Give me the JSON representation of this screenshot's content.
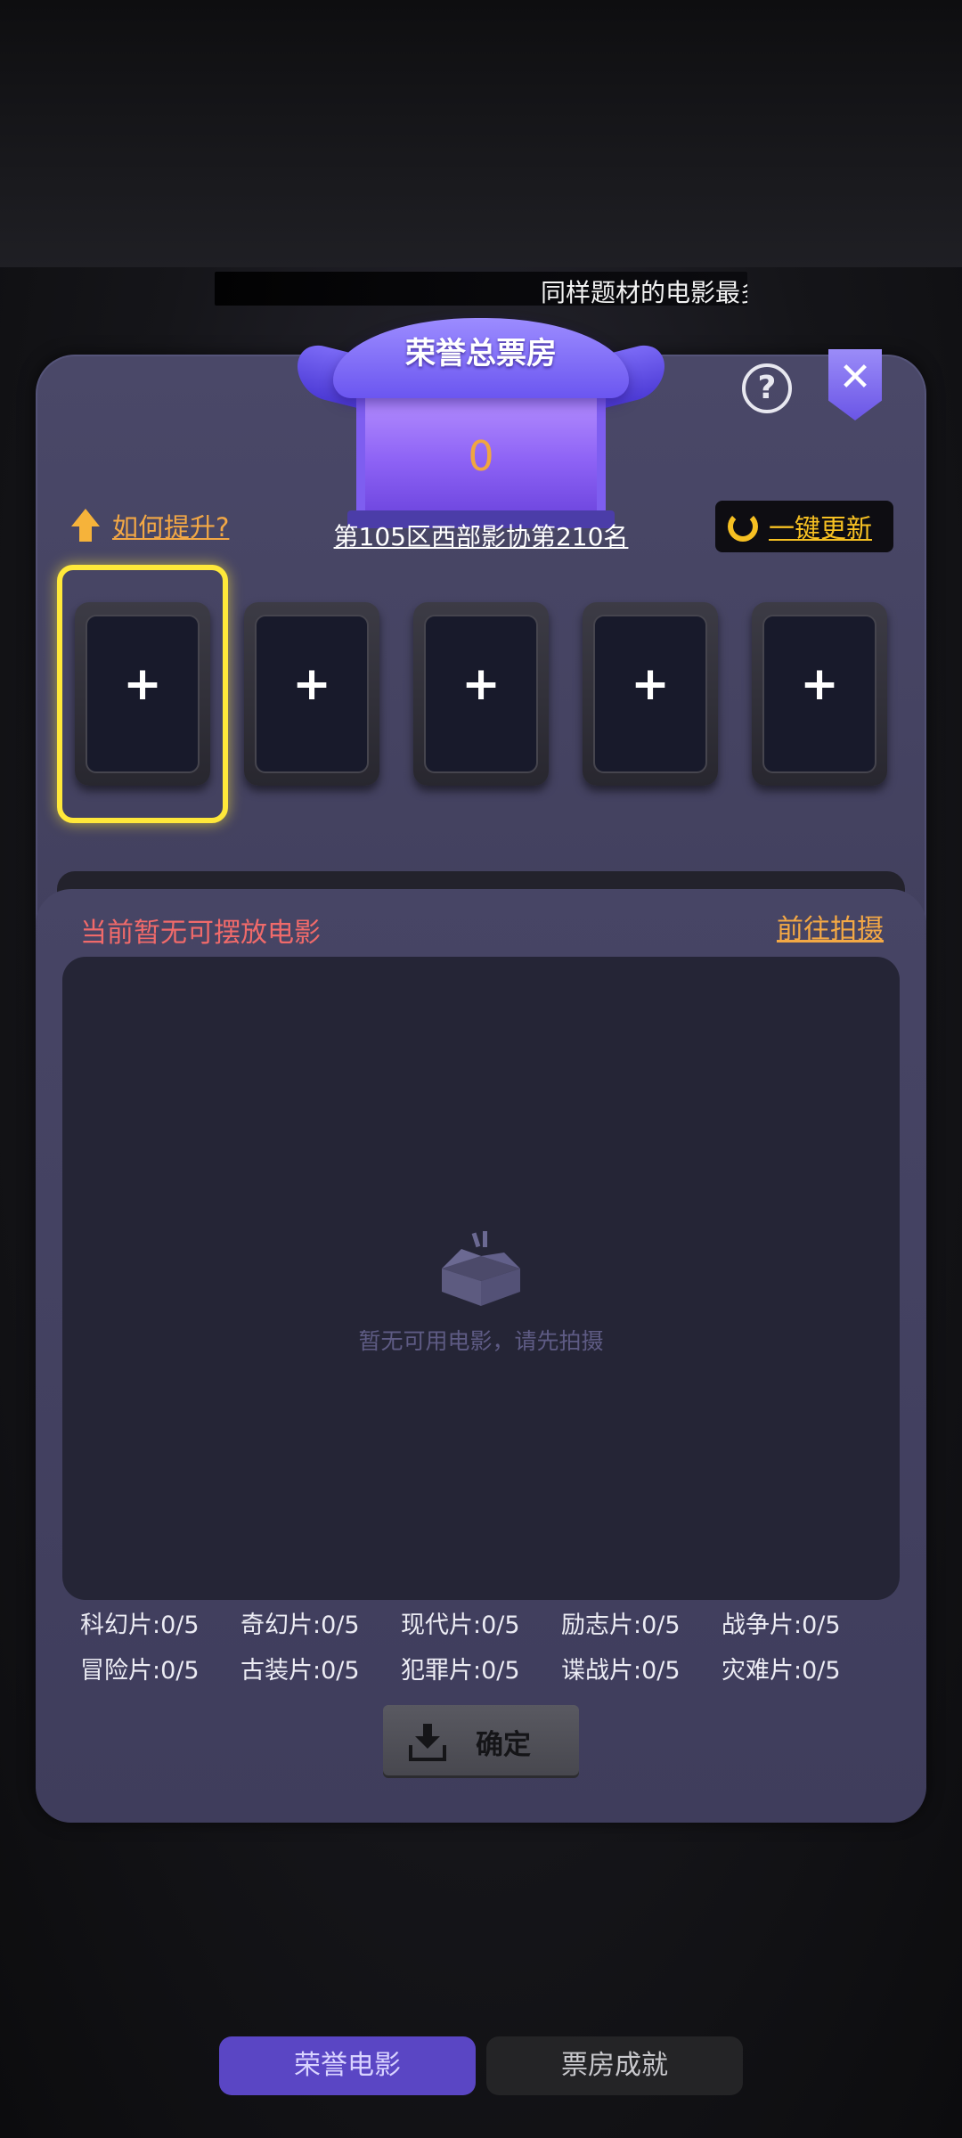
{
  "marquee": {
    "text": "同样题材的电影最多"
  },
  "header": {
    "title": "荣誉总票房",
    "score": "0",
    "rank": "第105区西部影协第210名"
  },
  "actions": {
    "improve_label": "如何提升?",
    "update_label": "一键更新",
    "help_label": "?",
    "close_label": "✕"
  },
  "slots": [
    {
      "label": "+",
      "selected": true
    },
    {
      "label": "+",
      "selected": false
    },
    {
      "label": "+",
      "selected": false
    },
    {
      "label": "+",
      "selected": false
    },
    {
      "label": "+",
      "selected": false
    }
  ],
  "lower": {
    "no_movie_text": "当前暂无可摆放电影",
    "goto_shoot_label": "前往拍摄",
    "empty_text": "暂无可用电影，请先拍摄"
  },
  "genres": [
    "科幻片:0/5",
    "奇幻片:0/5",
    "现代片:0/5",
    "励志片:0/5",
    "战争片:0/5",
    "冒险片:0/5",
    "古装片:0/5",
    "犯罪片:0/5",
    "谍战片:0/5",
    "灾难片:0/5"
  ],
  "confirm_label": "确定",
  "tabs": [
    {
      "label": "荣誉电影",
      "active": true
    },
    {
      "label": "票房成就",
      "active": false
    }
  ],
  "colors": {
    "accent_purple": "#6b56f0",
    "highlight_yellow": "#ffe83a",
    "link_orange": "#f3a845",
    "warning_red": "#f06a6a"
  }
}
